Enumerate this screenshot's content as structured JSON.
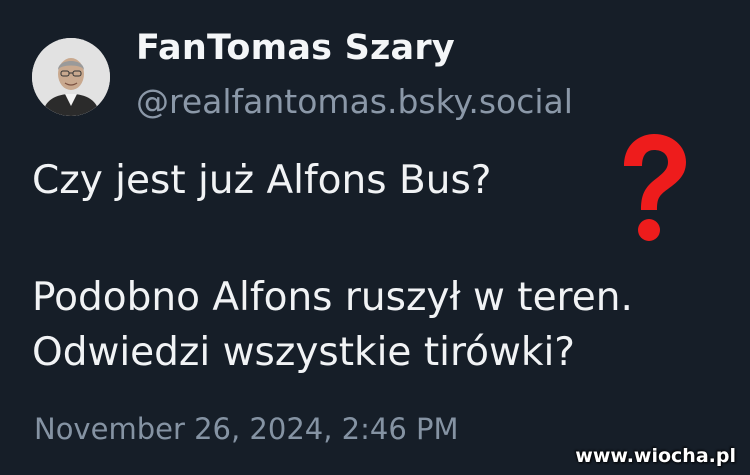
{
  "author": {
    "display_name": "FanTomas Szary",
    "handle": "@realfantomas.bsky.social",
    "avatar_icon": "profile-photo"
  },
  "post": {
    "line1": "Czy jest już Alfons Bus?",
    "line2": "Podobno Alfons ruszył w teren.",
    "line3": "Odwiedzi wszystkie tirówki?",
    "timestamp": "November 26, 2024, 2:46 PM"
  },
  "overlay": {
    "question_mark_icon": "red-question-mark",
    "question_mark_color": "#ee1c1c",
    "watermark": "www.wiocha.pl"
  },
  "colors": {
    "background": "#161e28",
    "text": "#f1f3f5",
    "muted": "#8b98a8"
  }
}
